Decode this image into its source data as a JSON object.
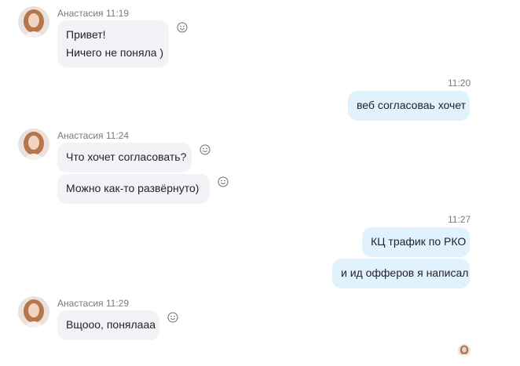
{
  "contact": {
    "name": "Анастасия"
  },
  "groups": [
    {
      "sender": "Анастасия",
      "time": "11:19",
      "messages": [
        "Привет!",
        "Ничего не поняла )"
      ]
    },
    {
      "sender": "me",
      "time": "11:20",
      "messages": [
        "веб согласоваь хочет"
      ]
    },
    {
      "sender": "Анастасия",
      "time": "11:24",
      "messages": [
        "Что хочет согласовать?",
        "Можно как-то развёрнуто)"
      ]
    },
    {
      "sender": "me",
      "time": "11:27",
      "messages": [
        "КЦ трафик по РКО",
        "и ид офферов я написал"
      ]
    },
    {
      "sender": "Анастасия",
      "time": "11:29",
      "messages": [
        "Вщооо, понялааа"
      ]
    }
  ],
  "icons": {
    "reaction": "smiley-icon",
    "read_receipt": "seen-avatar-icon"
  },
  "colors": {
    "incoming_bubble": "#f1f3f6",
    "outgoing_bubble": "#dff2fd",
    "meta_text": "#7a7a7a"
  }
}
